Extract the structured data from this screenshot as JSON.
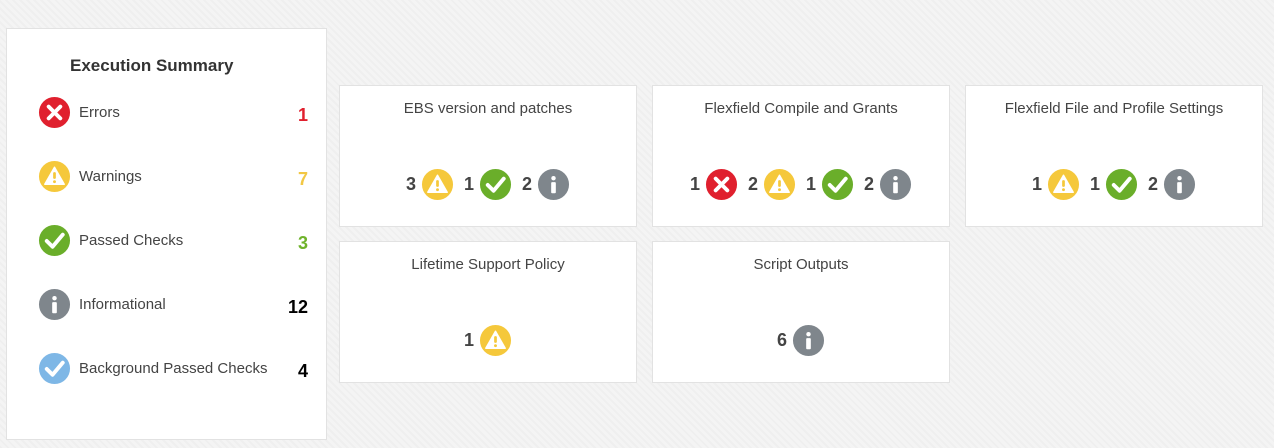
{
  "summary": {
    "title": "Execution Summary",
    "rows": [
      {
        "label": "Errors",
        "count": "1",
        "icon": "error-icon",
        "color": "#e0202e"
      },
      {
        "label": "Warnings",
        "count": "7",
        "icon": "warning-icon",
        "color": "#f2c744"
      },
      {
        "label": "Passed Checks",
        "count": "3",
        "icon": "passed-icon",
        "color": "#6fb32b"
      },
      {
        "label": "Informational",
        "count": "12",
        "icon": "info-icon",
        "color": "#000000"
      },
      {
        "label": "Background Passed Checks",
        "count": "4",
        "icon": "background-passed-icon",
        "color": "#000000"
      }
    ]
  },
  "cards": [
    {
      "title": "EBS version and patches",
      "badges": [
        {
          "count": "3",
          "icon": "warning-icon"
        },
        {
          "count": "1",
          "icon": "passed-icon"
        },
        {
          "count": "2",
          "icon": "info-icon"
        }
      ]
    },
    {
      "title": "Flexfield Compile and Grants",
      "badges": [
        {
          "count": "1",
          "icon": "error-icon"
        },
        {
          "count": "2",
          "icon": "warning-icon"
        },
        {
          "count": "1",
          "icon": "passed-icon"
        },
        {
          "count": "2",
          "icon": "info-icon"
        }
      ]
    },
    {
      "title": "Flexfield File and Profile Settings",
      "badges": [
        {
          "count": "1",
          "icon": "warning-icon"
        },
        {
          "count": "1",
          "icon": "passed-icon"
        },
        {
          "count": "2",
          "icon": "info-icon"
        }
      ]
    },
    {
      "title": "Lifetime Support Policy",
      "badges": [
        {
          "count": "1",
          "icon": "warning-icon"
        }
      ]
    },
    {
      "title": "Script Outputs",
      "badges": [
        {
          "count": "6",
          "icon": "info-icon"
        }
      ]
    }
  ]
}
